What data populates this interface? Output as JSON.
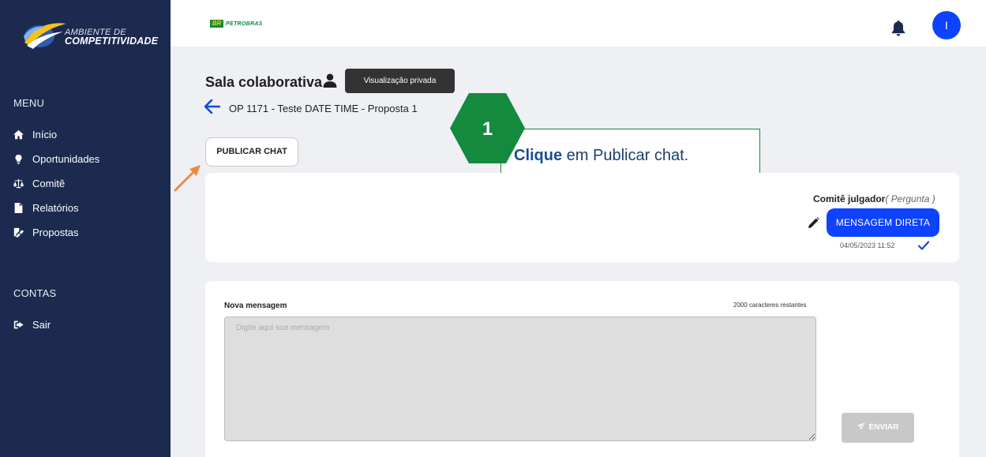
{
  "brand": {
    "logo_line1": "AMBIENTE DE",
    "logo_line2": "COMPETITIVIDADE",
    "partner_badge": "BR",
    "partner_name": "PETROBRAS"
  },
  "sidebar": {
    "menu_label": "MENU",
    "items": [
      {
        "label": "Início",
        "icon": "home-icon"
      },
      {
        "label": "Oportunidades",
        "icon": "lightbulb-icon"
      },
      {
        "label": "Comitê",
        "icon": "scale-icon"
      },
      {
        "label": "Relatórios",
        "icon": "document-icon"
      },
      {
        "label": "Propostas",
        "icon": "edit-document-icon"
      }
    ],
    "accounts_label": "CONTAS",
    "logout_label": "Sair"
  },
  "topbar": {
    "avatar_initial": "I"
  },
  "header": {
    "title": "Sala colaborativa",
    "tooltip": "Visualização privada",
    "breadcrumb": "OP 1171 - Teste DATE TIME - Proposta 1"
  },
  "actions": {
    "publish_chat": "PUBLICAR CHAT"
  },
  "callout": {
    "step": "1",
    "bold": "Clique",
    "rest": " em Publicar chat."
  },
  "chat": {
    "sender": "Comitê julgador",
    "sender_type": "( Pergunta )",
    "message": "MENSAGEM DIRETA",
    "timestamp": "04/05/2023 11:52"
  },
  "composer": {
    "label": "Nova mensagem",
    "chars_left": "2000 caracteres restantes",
    "placeholder": "Digite aqui sua mensagem",
    "send_label": "ENVIAR"
  },
  "colors": {
    "sidebar_bg": "#1b2a4e",
    "accent_blue": "#0d42ff",
    "callout_green": "#138a3e",
    "arrow_orange": "#e88a4a"
  }
}
